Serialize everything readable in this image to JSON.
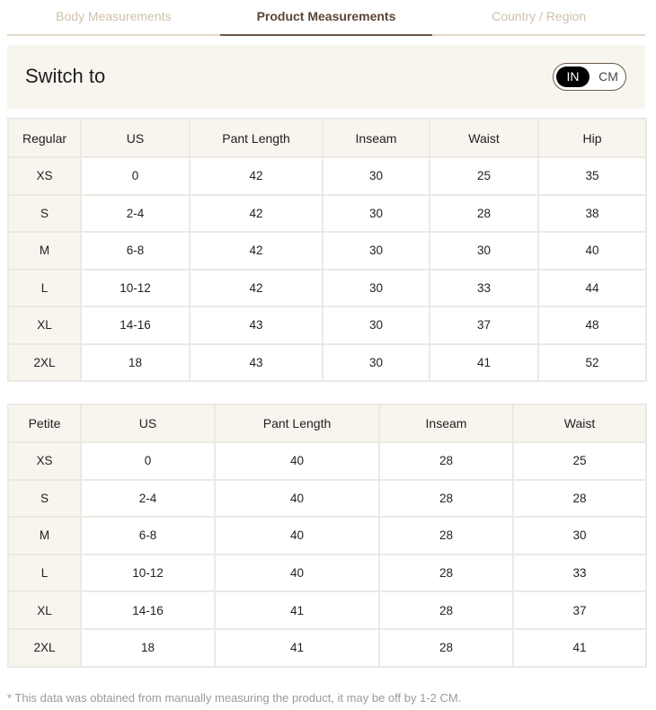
{
  "tabs": [
    {
      "label": "Body Measurements",
      "active": false
    },
    {
      "label": "Product Measurements",
      "active": true
    },
    {
      "label": "Country / Region",
      "active": false
    }
  ],
  "switch": {
    "title": "Switch to",
    "units": [
      "IN",
      "CM"
    ],
    "selected": "IN"
  },
  "regular_table": {
    "headers": [
      "Regular",
      "US",
      "Pant Length",
      "Inseam",
      "Waist",
      "Hip"
    ],
    "rows": [
      [
        "XS",
        "0",
        "42",
        "30",
        "25",
        "35"
      ],
      [
        "S",
        "2-4",
        "42",
        "30",
        "28",
        "38"
      ],
      [
        "M",
        "6-8",
        "42",
        "30",
        "30",
        "40"
      ],
      [
        "L",
        "10-12",
        "42",
        "30",
        "33",
        "44"
      ],
      [
        "XL",
        "14-16",
        "43",
        "30",
        "37",
        "48"
      ],
      [
        "2XL",
        "18",
        "43",
        "30",
        "41",
        "52"
      ]
    ]
  },
  "petite_table": {
    "headers": [
      "Petite",
      "US",
      "Pant Length",
      "Inseam",
      "Waist"
    ],
    "rows": [
      [
        "XS",
        "0",
        "40",
        "28",
        "25"
      ],
      [
        "S",
        "2-4",
        "40",
        "28",
        "28"
      ],
      [
        "M",
        "6-8",
        "40",
        "28",
        "30"
      ],
      [
        "L",
        "10-12",
        "40",
        "28",
        "33"
      ],
      [
        "XL",
        "14-16",
        "41",
        "28",
        "37"
      ],
      [
        "2XL",
        "18",
        "41",
        "28",
        "41"
      ]
    ]
  },
  "note": "* This data was obtained from manually measuring the product, it may be off by 1-2 CM.",
  "colors": {
    "accent": "#6b5443",
    "panel": "#f8f4ee",
    "border": "#ece9e4",
    "inactive_tab": "#cfc1ad"
  }
}
